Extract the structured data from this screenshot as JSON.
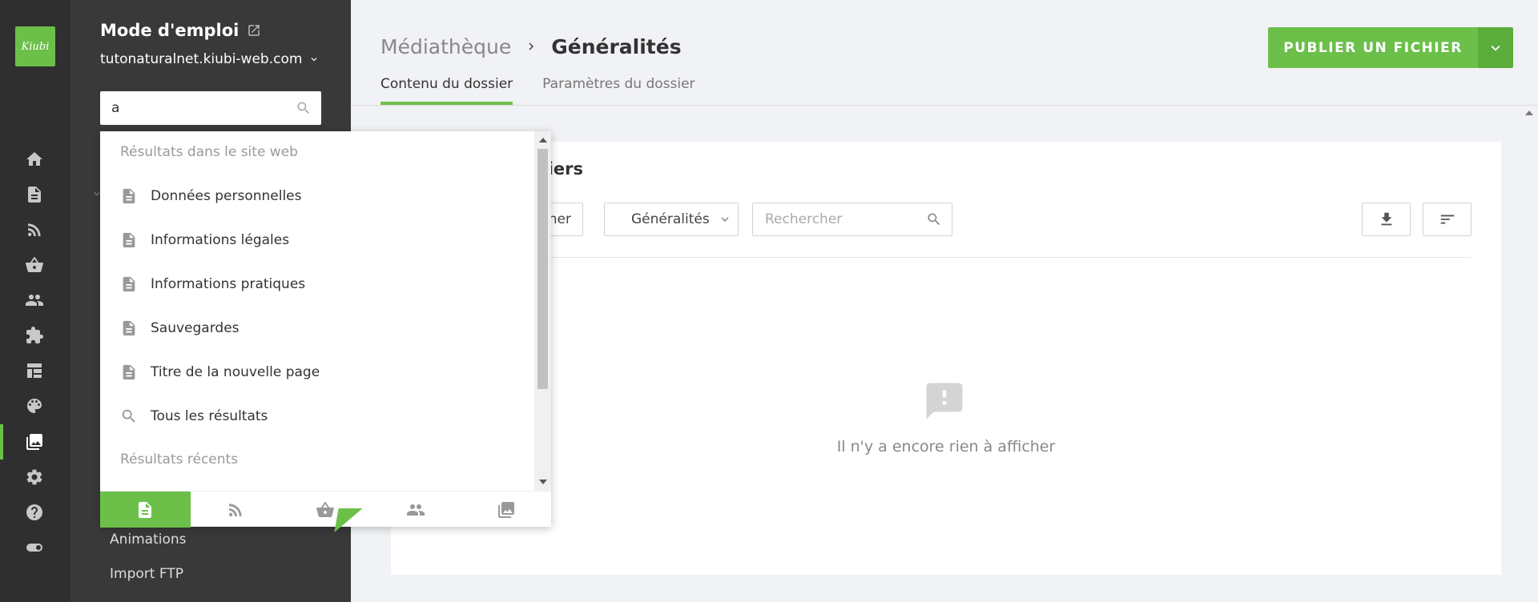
{
  "rail": {
    "logo_text": "Kiubi",
    "accent": "#6cc04a",
    "icons": [
      "home-icon",
      "document-icon",
      "rss-icon",
      "basket-icon",
      "users-icon",
      "puzzle-icon",
      "layout-icon",
      "palette-icon",
      "media-icon",
      "settings-icon",
      "help-icon",
      "toggle-icon"
    ],
    "active": "media-icon"
  },
  "nav": {
    "site_title": "Mode d'emploi",
    "site_url": "tutonaturalnet.kiubi-web.com",
    "search_value": "a",
    "links": [
      "Animations",
      "Import FTP"
    ]
  },
  "dropdown": {
    "section_site": "Résultats dans le site web",
    "items": [
      {
        "label": "Données personnelles",
        "icon": "document-icon"
      },
      {
        "label": "Informations légales",
        "icon": "document-icon"
      },
      {
        "label": "Informations pratiques",
        "icon": "document-icon"
      },
      {
        "label": "Sauvegardes",
        "icon": "document-icon"
      },
      {
        "label": "Titre de la nouvelle page",
        "icon": "document-icon"
      },
      {
        "label": "Tous les résultats",
        "icon": "search-icon"
      }
    ],
    "section_recent": "Résultats récents",
    "tabs": [
      "document-icon",
      "rss-icon",
      "basket-icon",
      "users-icon",
      "media-icon"
    ],
    "active_tab": "document-icon"
  },
  "main": {
    "breadcrumb": {
      "root": "Médiathèque",
      "current": "Généralités"
    },
    "publish_label": "PUBLIER UN FICHIER",
    "tabs": [
      {
        "label": "Contenu du dossier",
        "active": true
      },
      {
        "label": "Paramètres du dossier",
        "active": false
      }
    ],
    "card": {
      "title_partial": "iers",
      "select_button_partial": "nner",
      "folder_select": "Généralités",
      "search_placeholder": "Rechercher",
      "empty_text": "Il n'y a encore rien à afficher"
    }
  }
}
